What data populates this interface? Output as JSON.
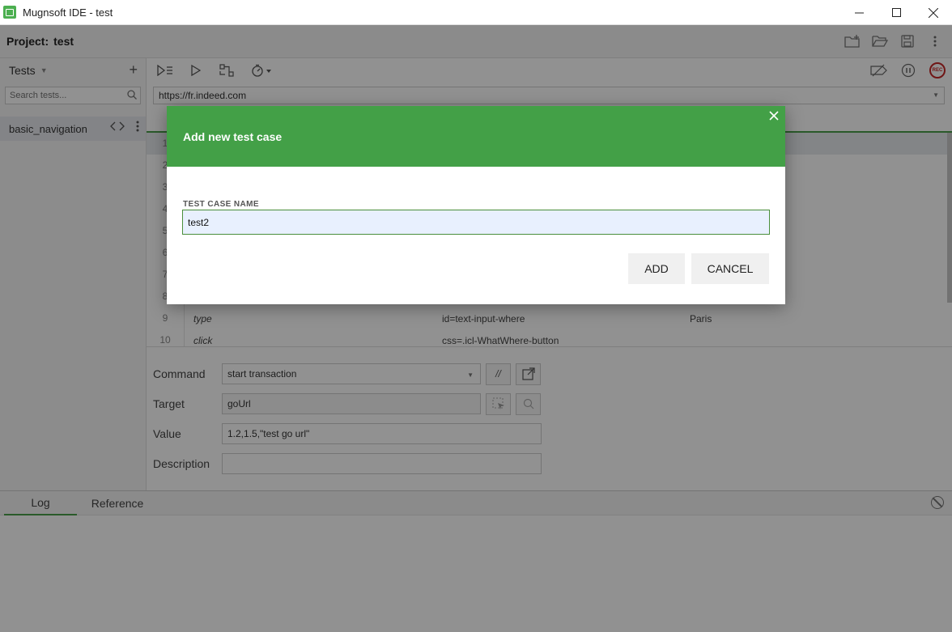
{
  "window": {
    "title": "Mugnsoft IDE - test",
    "icons": {
      "minimize": "minimize-icon",
      "maximize": "maximize-icon",
      "close": "close-icon"
    }
  },
  "project": {
    "label": "Project:",
    "name": "test"
  },
  "sidebar": {
    "title": "Tests",
    "search_placeholder": "Search tests...",
    "tests": [
      {
        "name": "basic_navigation"
      }
    ]
  },
  "editor": {
    "url": "https://fr.indeed.com",
    "rows": [
      {
        "num": "1",
        "command": "",
        "target": "",
        "value": ""
      },
      {
        "num": "2",
        "command": "",
        "target": "",
        "value": ""
      },
      {
        "num": "3",
        "command": "",
        "target": "",
        "value": ""
      },
      {
        "num": "4",
        "command": "",
        "target": "",
        "value": ""
      },
      {
        "num": "5",
        "command": "",
        "target": "",
        "value": ""
      },
      {
        "num": "6",
        "command": "",
        "target": "",
        "value": ""
      },
      {
        "num": "7",
        "command": "",
        "target": "",
        "value": ""
      },
      {
        "num": "8",
        "command": "",
        "target": "",
        "value": ""
      },
      {
        "num": "9",
        "command": "type",
        "target": "id=text-input-where",
        "value": "Paris"
      },
      {
        "num": "10",
        "command": "click",
        "target": "css=.icl-WhatWhere-button",
        "value": ""
      }
    ]
  },
  "properties": {
    "command_label": "Command",
    "command_value": "start transaction",
    "comment_btn": "//",
    "target_label": "Target",
    "target_value": "goUrl",
    "value_label": "Value",
    "value_value": "1.2,1.5,\"test go url\"",
    "description_label": "Description",
    "description_value": ""
  },
  "log": {
    "tabs": [
      "Log",
      "Reference"
    ],
    "active": "Log"
  },
  "dialog": {
    "title": "Add new test case",
    "field_label": "TEST CASE NAME",
    "field_value": "test2",
    "add_label": "ADD",
    "cancel_label": "CANCEL"
  },
  "colors": {
    "accent": "#43a047",
    "record": "#c62828"
  }
}
